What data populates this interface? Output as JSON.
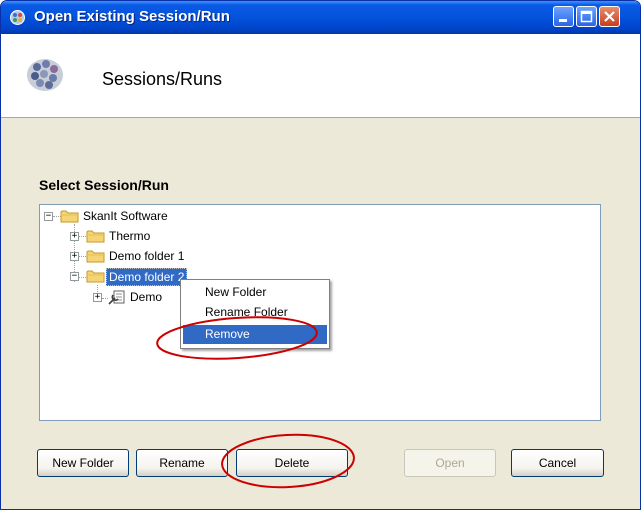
{
  "window": {
    "title": "Open Existing Session/Run"
  },
  "header": {
    "title": "Sessions/Runs"
  },
  "section": {
    "label": "Select Session/Run"
  },
  "tree": {
    "root": "SkanIt Software",
    "children": [
      "Thermo",
      "Demo folder 1",
      "Demo folder 2"
    ],
    "grandchild": "Demo"
  },
  "context_menu": {
    "items": [
      "New Folder",
      "Rename Folder",
      "Remove"
    ],
    "highlighted": "Remove"
  },
  "buttons": {
    "new_folder": "New Folder",
    "rename": "Rename",
    "delete": "Delete",
    "open": "Open",
    "cancel": "Cancel"
  },
  "colors": {
    "selection": "#316ac5",
    "annotation": "#cc0000",
    "titlebar": "#0454dd"
  },
  "icons": [
    "app-icon",
    "minimize-icon",
    "maximize-icon",
    "close-icon",
    "sessions-logo-icon",
    "folder-icon",
    "wrench-icon",
    "expander-icon"
  ]
}
